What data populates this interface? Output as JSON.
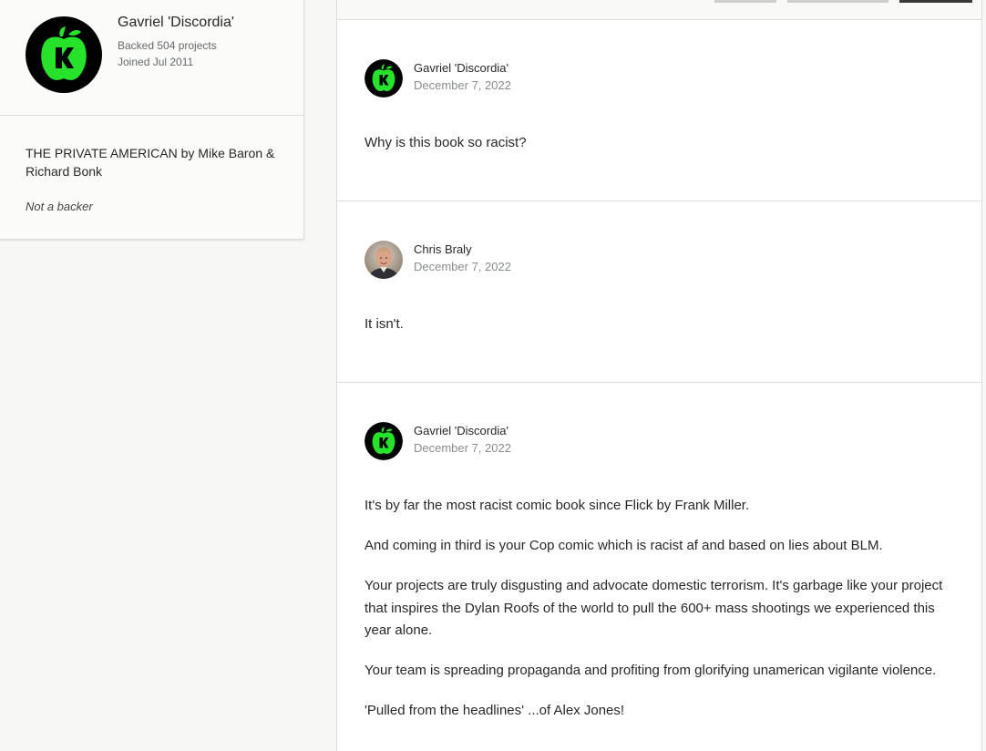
{
  "profile": {
    "name": "Gavriel 'Discordia'",
    "backed": "Backed 504 projects",
    "joined": "Joined Jul 2011",
    "avatar_icon": "kickstarter-apple-icon",
    "project": "THE PRIVATE AMERICAN by Mike Baron & Richard Bonk",
    "backer_status": "Not a backer"
  },
  "colors": {
    "apple_green": "#27e22b",
    "avatar_black": "#000000"
  },
  "comments": [
    {
      "author": "Gavriel 'Discordia'",
      "date": "December 7, 2022",
      "avatar_icon": "kickstarter-apple-icon",
      "paragraphs": [
        "Why is this book so racist?"
      ]
    },
    {
      "author": "Chris Braly",
      "date": "December 7, 2022",
      "avatar_icon": "user-photo-avatar",
      "paragraphs": [
        "It isn't."
      ]
    },
    {
      "author": "Gavriel 'Discordia'",
      "date": "December 7, 2022",
      "avatar_icon": "kickstarter-apple-icon",
      "paragraphs": [
        "It's by far the most racist comic book since Flick by Frank Miller.",
        "And coming in third is your Cop comic which is racist af and based on lies about BLM.",
        "Your projects are truly disgusting and advocate domestic terrorism. It's garbage like your project that inspires the Dylan Roofs of the world to pull the 600+ mass shootings we experienced this year alone.",
        "Your team is spreading propaganda and profiting from glorifying unamerican vigilante violence.",
        "'Pulled from the headlines' ...of Alex Jones!"
      ]
    }
  ]
}
